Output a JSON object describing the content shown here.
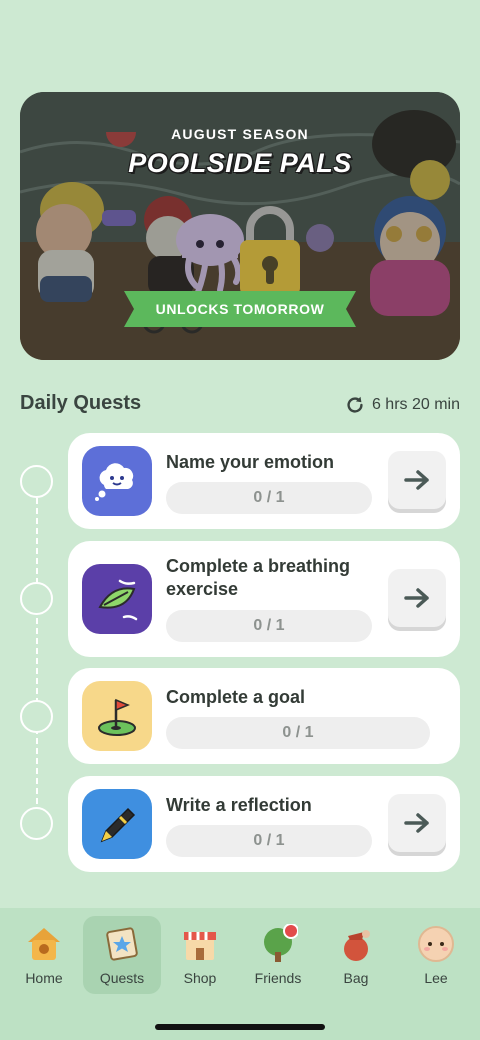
{
  "banner": {
    "season_label": "AUGUST SEASON",
    "title": "POOLSIDE PALS",
    "status": "UNLOCKS TOMORROW"
  },
  "daily_quests": {
    "heading": "Daily Quests",
    "timer": "6 hrs 20 min",
    "items": [
      {
        "title": "Name your emotion",
        "progress": "0 / 1",
        "icon": "thought-cloud-icon",
        "color": "#5d6fd8"
      },
      {
        "title": "Complete a breathing exercise",
        "progress": "0 / 1",
        "icon": "leaf-wind-icon",
        "color": "#5b3fa8"
      },
      {
        "title": "Complete a goal",
        "progress": "0 / 1",
        "icon": "golf-flag-icon",
        "color": "#f7d88a"
      },
      {
        "title": "Write a reflection",
        "progress": "0 / 1",
        "icon": "pen-icon",
        "color": "#3f8fe0"
      }
    ]
  },
  "nav": {
    "items": [
      {
        "label": "Home",
        "icon": "home-icon"
      },
      {
        "label": "Quests",
        "icon": "quests-icon",
        "active": true
      },
      {
        "label": "Shop",
        "icon": "shop-icon"
      },
      {
        "label": "Friends",
        "icon": "friends-icon",
        "badge": true
      },
      {
        "label": "Bag",
        "icon": "bag-icon"
      },
      {
        "label": "Lee",
        "icon": "avatar-icon"
      }
    ]
  },
  "colors": {
    "background": "#cde9d2",
    "ribbon": "#5cb85c",
    "lock": "#f2cf47"
  }
}
